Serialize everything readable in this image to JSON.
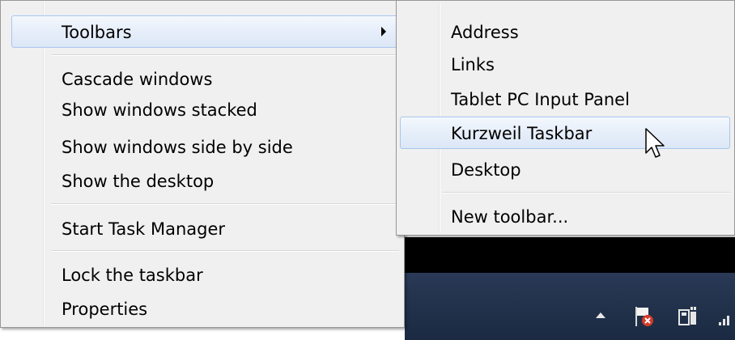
{
  "main_menu": {
    "items": [
      {
        "label": "Toolbars",
        "has_submenu": true,
        "highlighted": true
      },
      {
        "label": "Cascade windows"
      },
      {
        "label": "Show windows stacked"
      },
      {
        "label": "Show windows side by side"
      },
      {
        "label": "Show the desktop"
      },
      {
        "label": "Start Task Manager"
      },
      {
        "label": "Lock the taskbar"
      },
      {
        "label": "Properties"
      }
    ]
  },
  "toolbars_submenu": {
    "items": [
      {
        "label": "Address"
      },
      {
        "label": "Links"
      },
      {
        "label": "Tablet PC Input Panel"
      },
      {
        "label": "Kurzweil Taskbar",
        "highlighted": true
      },
      {
        "label": "Desktop"
      },
      {
        "label": "New toolbar..."
      }
    ]
  },
  "tray": {
    "icons": [
      "show-hidden-icons-arrow",
      "action-center-flag-icon",
      "network-icon",
      "signal-icon"
    ]
  },
  "colors": {
    "menu_bg": "#f0f0f0",
    "highlight_border": "#a8c6ee",
    "taskbar": "#23334d"
  }
}
